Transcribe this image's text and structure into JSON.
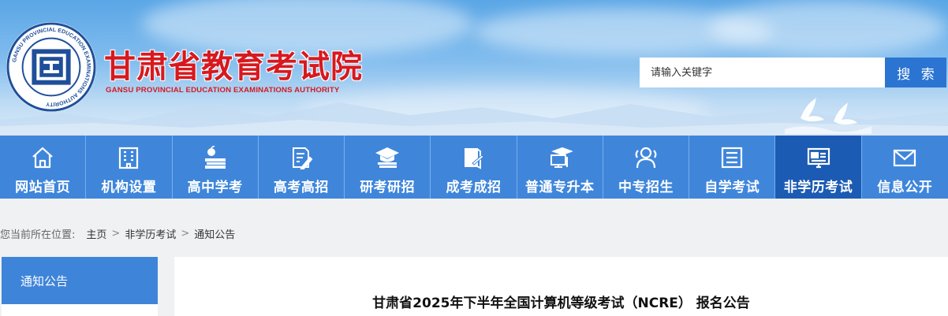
{
  "header": {
    "site_title": "甘肃省教育考试院",
    "site_subtitle": "GANSU PROVINCIAL EDUCATION EXAMINATIONS AUTHORITY",
    "logo_ring_text": "GANSU PROVINCIAL EDUCATION EXAMINATIONS AUTHORITY",
    "logo_top_text": "甘肃省教育考试院"
  },
  "search": {
    "placeholder": "请输入关键字",
    "button_label": "搜 索"
  },
  "nav": {
    "items": [
      {
        "label": "网站首页",
        "icon": "home-icon"
      },
      {
        "label": "机构设置",
        "icon": "building-icon"
      },
      {
        "label": "高中学考",
        "icon": "apple-books-icon"
      },
      {
        "label": "高考高招",
        "icon": "document-pen-icon"
      },
      {
        "label": "研考研招",
        "icon": "graduation-cap-icon"
      },
      {
        "label": "成考成招",
        "icon": "book-pen-icon"
      },
      {
        "label": "普通专升本",
        "icon": "desk-monitor-icon"
      },
      {
        "label": "中专招生",
        "icon": "users-icon"
      },
      {
        "label": "自学考试",
        "icon": "list-icon"
      },
      {
        "label": "非学历考试",
        "icon": "id-card-icon"
      },
      {
        "label": "信息公开",
        "icon": "mail-icon"
      }
    ],
    "active_index": 9
  },
  "breadcrumb": {
    "prefix": "您当前所在位置:",
    "items": [
      "主页",
      "非学历考试",
      "通知公告"
    ],
    "separator": ">"
  },
  "sidebar": {
    "title": "通知公告"
  },
  "article": {
    "title": "甘肃省2025年下半年全国计算机等级考试（NCRE） 报名公告"
  },
  "colors": {
    "brand_red": "#d7191f",
    "nav_blue": "#3f86db",
    "nav_active": "#1c5bb3",
    "search_button": "#2b74d2"
  }
}
